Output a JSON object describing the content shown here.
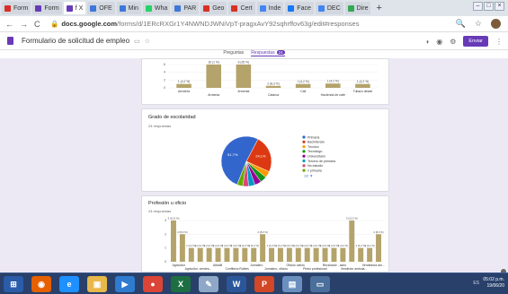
{
  "browser": {
    "tabs": [
      {
        "label": "Form",
        "color": "#d93025"
      },
      {
        "label": "Form",
        "color": "#673ab7"
      },
      {
        "label": "f X",
        "color": "#673ab7",
        "active": true
      },
      {
        "label": "OFE",
        "color": "#3c78d8"
      },
      {
        "label": "Min",
        "color": "#3c78d8"
      },
      {
        "label": "Wha",
        "color": "#25d366"
      },
      {
        "label": "PAR",
        "color": "#3c78d8"
      },
      {
        "label": "Geo",
        "color": "#d93025"
      },
      {
        "label": "Cert",
        "color": "#d93025"
      },
      {
        "label": "Inde",
        "color": "#4285f4"
      },
      {
        "label": "Face",
        "color": "#1877f2"
      },
      {
        "label": "DEC",
        "color": "#4285f4"
      },
      {
        "label": "Dire",
        "color": "#34a853"
      }
    ],
    "new_tab": "+",
    "url_domain": "docs.google.com",
    "url_path": "/forms/d/1ERcRXGr1Y4NWNDJWNiVpT-pragxAvY92sqhrffov63g/edit#responses",
    "nav": {
      "back": "←",
      "forward": "→",
      "reload": "C"
    },
    "right_icons": {
      "search": "🔍",
      "star": "☆"
    }
  },
  "form": {
    "title": "Formulario de solicitud de empleo",
    "send_label": "Enviar",
    "tabs": [
      {
        "label": "Preguntas"
      },
      {
        "label": "Respuestas",
        "badge": "24"
      }
    ],
    "accent": "#673ab7"
  },
  "chart_top": {
    "categories": [
      "Armenia",
      "Armenia",
      "Armenia",
      "Calarca",
      "Cali",
      "Hacienda de cafe",
      "Tuliazo desde"
    ],
    "values": [
      1,
      6,
      6,
      0.5,
      1,
      1.1,
      1
    ],
    "labels": [
      "1 (4,2 %)",
      "16 (1 %)",
      "6 (25 %)",
      "2 (8,3 %)",
      "1 (4,2 %)",
      "1 (4,2 %)",
      "1 (4,2 %)"
    ],
    "ymax": 6,
    "color": "#b4a36a"
  },
  "chart_pie": {
    "title": "Grado de escolaridad",
    "subtitle": "24 respuestas",
    "type": "pie",
    "slices": [
      {
        "name": "Primaria",
        "value": 51.7,
        "color": "#3366cc"
      },
      {
        "name": "Bachillerato",
        "value": 24.1,
        "color": "#dc3912"
      },
      {
        "name": "Técnico",
        "value": 4.2,
        "color": "#ff9900"
      },
      {
        "name": "Tecnólogo",
        "value": 4.2,
        "color": "#109618"
      },
      {
        "name": "Universitario",
        "value": 4.2,
        "color": "#990099"
      },
      {
        "name": "Tercero de primaria",
        "value": 4.2,
        "color": "#0099c6"
      },
      {
        "name": "No estudio",
        "value": 3.7,
        "color": "#dd4477"
      },
      {
        "name": "v primaria",
        "value": 3.7,
        "color": "#66aa00"
      }
    ],
    "slice_labels": [
      "51,7%",
      "24,1%"
    ],
    "pager": "1/2 ▼"
  },
  "chart_bottom": {
    "title": "Profesión u oficio",
    "subtitle": "24 respuestas",
    "type": "bar",
    "values": [
      3,
      2,
      1,
      1,
      1,
      1,
      1,
      1,
      1,
      1,
      2,
      1,
      1,
      1,
      1,
      1,
      1,
      1,
      1,
      1,
      3,
      1,
      1,
      2
    ],
    "top_labels": [
      "3 (12,5 %)",
      "2 (8,3 %)",
      "",
      "",
      "",
      "",
      "",
      "",
      "",
      "",
      "2 (8,3 %)",
      "",
      "",
      "",
      "",
      "",
      "",
      "",
      "",
      "",
      "3 (12,5 %)",
      "",
      "",
      "2 (8,3 %)"
    ],
    "small_label": "1 (4,2 %)",
    "xlabels": [
      "Agricultor",
      "Agricultor, vendes...",
      "Albañil",
      "Confitería Robles",
      "Jornalero",
      "Jornalero, oficios",
      "Oficios varios",
      "Pintor profesional",
      "Reciclador - aseo",
      "Vendedor ambula...",
      "Vendedora am..."
    ],
    "ymax": 3,
    "ticks": [
      "0",
      "1",
      "2",
      "3"
    ],
    "color": "#b4a36a"
  },
  "taskbar": {
    "apps": [
      {
        "name": "start",
        "glyph": "⊞",
        "color": "#2a5caa"
      },
      {
        "name": "firefox",
        "glyph": "◉",
        "color": "#e66000"
      },
      {
        "name": "ie",
        "glyph": "e",
        "color": "#1e90ff"
      },
      {
        "name": "explorer",
        "glyph": "▣",
        "color": "#e8b84a"
      },
      {
        "name": "media",
        "glyph": "▶",
        "color": "#2e7bcf"
      },
      {
        "name": "chrome",
        "glyph": "●",
        "color": "#db4437"
      },
      {
        "name": "excel",
        "glyph": "X",
        "color": "#1d6f42"
      },
      {
        "name": "paint",
        "glyph": "✎",
        "color": "#8fa8c8"
      },
      {
        "name": "word",
        "glyph": "W",
        "color": "#2b579a"
      },
      {
        "name": "powerpoint",
        "glyph": "P",
        "color": "#d24726"
      },
      {
        "name": "network",
        "glyph": "▤",
        "color": "#6a8fbf"
      },
      {
        "name": "display",
        "glyph": "▭",
        "color": "#4a6f9a"
      }
    ],
    "tray": "ES",
    "time": "05:02 p.m.",
    "date": "19/06/20"
  }
}
